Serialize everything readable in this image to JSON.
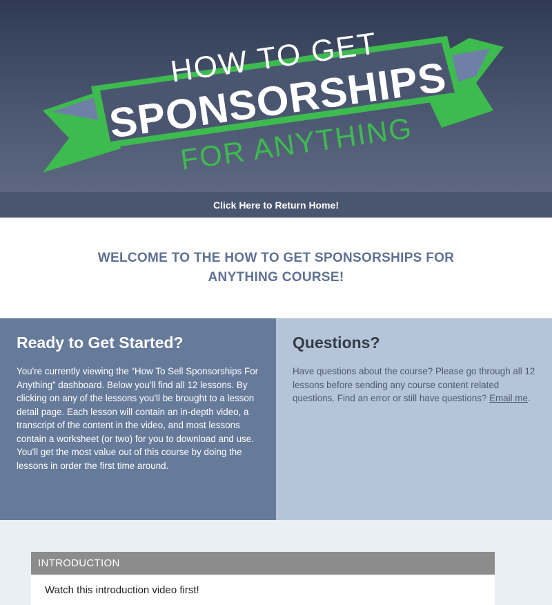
{
  "hero": {
    "line1": "HOW TO GET",
    "line2": "SPONSORSHIPS",
    "line3": "FOR ANYTHING",
    "colors": {
      "ribbon": "#3dbb4f",
      "accent": "#6f80a6",
      "text": "#ffffff"
    }
  },
  "nav": {
    "return_label": "Click Here to Return Home!"
  },
  "welcome": {
    "title": "WELCOME TO THE HOW TO GET SPONSORSHIPS FOR ANYTHING COURSE!"
  },
  "ready": {
    "title": "Ready to Get Started?",
    "body": "You're currently viewing the “How To Sell Sponsorships For Anything” dashboard. Below you'll find all 12 lessons. By clicking on any of the lessons you'll be brought to a lesson detail page. Each lesson will contain an in-depth video, a transcript of the content in the video, and most lessons contain a worksheet (or two) for you to download and use. You'll get the most value out of this course by doing the lessons in order the first time around."
  },
  "questions": {
    "title": "Questions?",
    "body": "Have questions about the course? Please go through all 12 lessons before sending any course content related questions. Find an error or still have questions?",
    "link_label": "Email me",
    "after_link": "."
  },
  "intro": {
    "header": "INTRODUCTION",
    "text": "Watch this introduction video first!"
  }
}
